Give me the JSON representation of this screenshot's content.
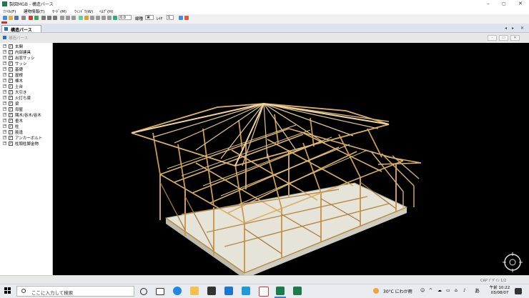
{
  "window": {
    "title": "製図MGB - 構造パース",
    "min": "–",
    "max": "▢",
    "close": "✕"
  },
  "menu": [
    "ﾌｧｲﾙ(F)",
    "建物情報(T)",
    "ﾓｰﾄﾞ(M)",
    "ｳｨﾝﾄﾞｳ(W)",
    "ﾍﾙﾌﾟ(H)"
  ],
  "toolbar": {
    "zoom_value": "0.0",
    "line_type_label": "線種",
    "line_type_value": "実",
    "layer_label": "ﾚｲﾔ",
    "layer_value": "1"
  },
  "tab": {
    "label": "構造パース"
  },
  "pane": {
    "title": "構造パース"
  },
  "tree": {
    "items": [
      {
        "label": "玄関",
        "checked": true
      },
      {
        "label": "内部建具",
        "checked": true
      },
      {
        "label": "出窓サッシ",
        "checked": true
      },
      {
        "label": "サッシ",
        "checked": true
      },
      {
        "label": "基礎",
        "checked": true
      },
      {
        "label": "屋根",
        "checked": false
      },
      {
        "label": "棟木",
        "checked": true
      },
      {
        "label": "土台",
        "checked": true
      },
      {
        "label": "大引き",
        "checked": true
      },
      {
        "label": "火打ち梁",
        "checked": true
      },
      {
        "label": "梁",
        "checked": true
      },
      {
        "label": "母屋",
        "checked": true
      },
      {
        "label": "隅木/谷木/谷木",
        "checked": true
      },
      {
        "label": "垂木",
        "checked": true
      },
      {
        "label": "柱",
        "checked": true
      },
      {
        "label": "筋違",
        "checked": true
      },
      {
        "label": "アンカーボルト",
        "checked": true
      },
      {
        "label": "柱頭柱脚金物",
        "checked": true
      }
    ]
  },
  "status": {
    "text": "CAP ﾃﾞｻﾞｲﾝ 1/2"
  },
  "taskbar": {
    "search_placeholder": "ここに入力して検索",
    "weather": "30°C にわか雨",
    "ime": "あ",
    "time": "午前 10:22",
    "date": "03/08/07"
  },
  "colors": {
    "viewport_bg": "#000000",
    "frame_light": "#e2c590",
    "frame_mid": "#c99a52",
    "frame_dark": "#9c7030"
  }
}
